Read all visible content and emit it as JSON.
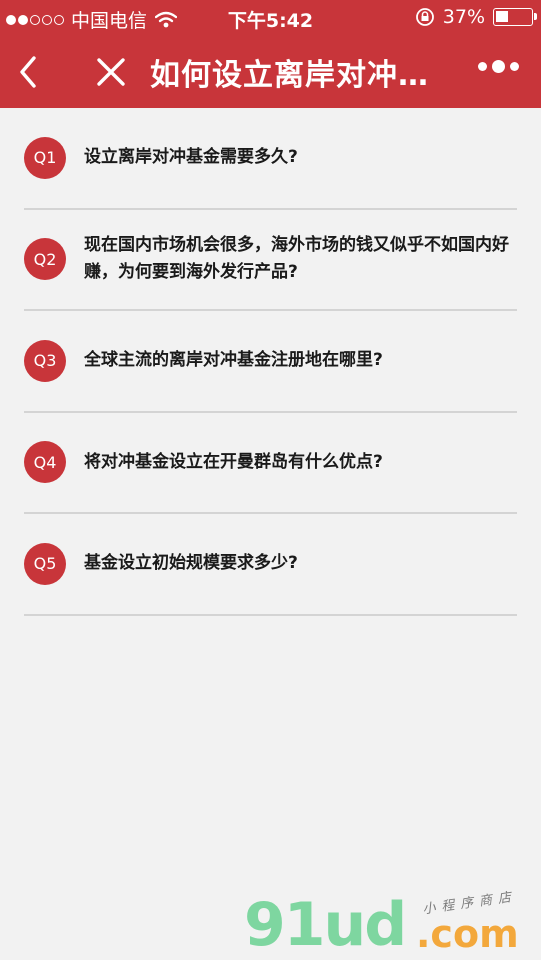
{
  "status_bar": {
    "carrier": "中国电信",
    "time": "下午5:42",
    "battery_percent": "37%",
    "battery_level": 0.37,
    "signal_dots_filled": 2,
    "signal_dots_total": 5,
    "icons": [
      "wifi-icon",
      "rotation-lock-icon",
      "battery-icon"
    ]
  },
  "navbar": {
    "title": "如何设立离岸对冲…",
    "back_icon": "chevron-left-icon",
    "close_icon": "close-icon",
    "more_icon": "more-dots-icon",
    "background_color": "#c8353a"
  },
  "faq": [
    {
      "badge": "Q1",
      "question": "设立离岸对冲基金需要多久?"
    },
    {
      "badge": "Q2",
      "question": "现在国内市场机会很多，海外市场的钱又似乎不如国内好赚，为何要到海外发行产品?"
    },
    {
      "badge": "Q3",
      "question": "全球主流的离岸对冲基金注册地在哪里?"
    },
    {
      "badge": "Q4",
      "question": "将对冲基金设立在开曼群岛有什么优点?"
    },
    {
      "badge": "Q5",
      "question": "基金设立初始规模要求多少?"
    }
  ],
  "watermark": {
    "main": "91ud",
    "com": ".com",
    "sub": "小程序商店"
  }
}
